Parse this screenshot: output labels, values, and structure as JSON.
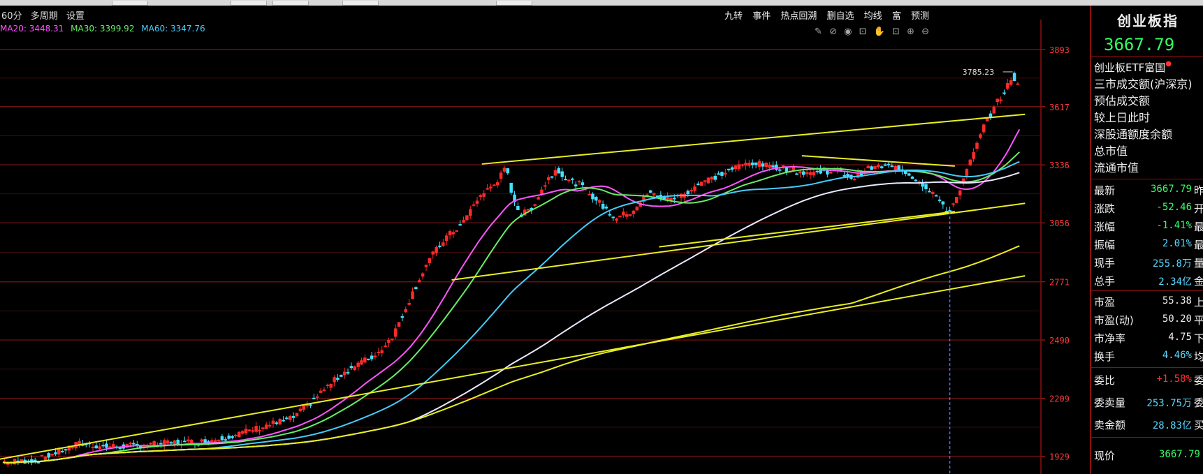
{
  "toolbar": {
    "items": [
      "60分",
      "多周期",
      "设置"
    ]
  },
  "ma_legend": [
    {
      "label": "MA20: 3448.31",
      "color": "#ff55ff"
    },
    {
      "label": "MA30: 3399.92",
      "color": "#66ee66"
    },
    {
      "label": "MA60: 3347.76",
      "color": "#44ccff"
    }
  ],
  "right_tools": [
    "九转",
    "事件",
    "热点回溯",
    "删自选",
    "均线",
    "富",
    "预测"
  ],
  "mini_icons": [
    "✎",
    "⊘",
    "◉",
    "⊡",
    "✋",
    "⊡",
    "⊕",
    "⊖"
  ],
  "chart_data": {
    "type": "candlestick",
    "y_ticks": [
      1929,
      2209,
      2490,
      2771,
      3056,
      3336,
      3617,
      3893
    ],
    "ylim": [
      1880,
      3950
    ],
    "max_label": "3785.23",
    "grid": true,
    "candles_note": "hourly candles, ~320 bars",
    "series_colors": {
      "ma20": "#ff55ff",
      "ma30": "#66ee66",
      "ma60": "#44ccff",
      "ma120": "#e8e8ff",
      "ma250": "#e8ee22",
      "trendline": "#e8ee22",
      "up_candle": "#ff2a2a",
      "down_candle": "#44e0ff"
    }
  },
  "info": {
    "name": "创业板指",
    "price": "3667.79",
    "etf": "创业板ETF富国",
    "links": [
      "三市成交额(沪深京)",
      "预估成交额",
      "较上日此时",
      "深股通额度余额",
      "总市值",
      "流通市值"
    ],
    "quotes": [
      {
        "label": "最新",
        "value": "3667.79",
        "tail": "昨",
        "color": "green"
      },
      {
        "label": "涨跌",
        "value": "-52.46",
        "tail": "开",
        "color": "green"
      },
      {
        "label": "涨幅",
        "value": "-1.41%",
        "tail": "最",
        "color": "green"
      },
      {
        "label": "振幅",
        "value": "2.01%",
        "tail": "最",
        "color": "cyan"
      },
      {
        "label": "现手",
        "value": "255.8万",
        "tail": "量",
        "color": "cyan"
      },
      {
        "label": "总手",
        "value": "2.34亿",
        "tail": "金",
        "color": "cyan"
      }
    ],
    "valuation": [
      {
        "label": "市盈",
        "value": "55.38",
        "tail": "上",
        "color": "white"
      },
      {
        "label": "市盈(动)",
        "value": "50.20",
        "tail": "平",
        "color": "white"
      },
      {
        "label": "市净率",
        "value": "4.75",
        "tail": "下",
        "color": "white"
      },
      {
        "label": "换手",
        "value": "4.46%",
        "tail": "均",
        "color": "cyan"
      }
    ],
    "orders": [
      {
        "label": "委比",
        "value": "+1.58%",
        "tail": "委",
        "color": "red"
      },
      {
        "label": "委卖量",
        "value": "253.75万",
        "tail": "委",
        "color": "cyan"
      },
      {
        "label": "卖金额",
        "value": "28.83亿",
        "tail": "买",
        "color": "cyan"
      }
    ],
    "current": {
      "label": "现价",
      "value": "3667.79"
    }
  }
}
